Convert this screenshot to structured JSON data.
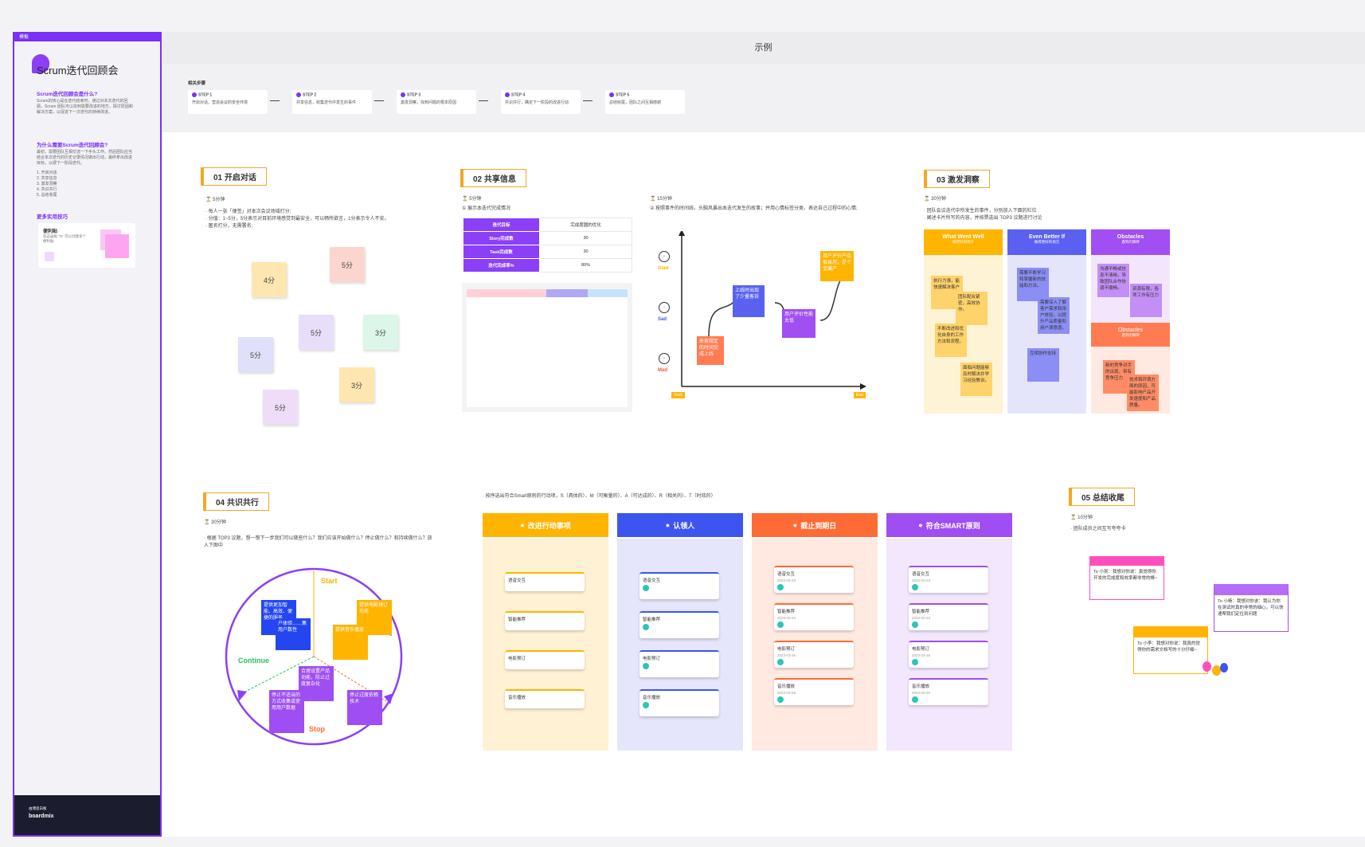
{
  "sidebar": {
    "tag": "模板",
    "title": "Scrum迭代回顾会",
    "h1": "Scrum迭代回顾会是什么?",
    "p1": "Scrum的核心是在迭代结束时，通过对本次迭代的回顾，Scrum 团队可以找到需要改进的地方，探讨原因和解决方案，以促进下一次迭代的持续改进。",
    "h2": "为什么需要Scrum迭代回顾会?",
    "p2": "最初，需要团队互相交流一下手头工作。然后团队应当结合本次迭代的历史记录情况做出行动，最终拿出改进目标，以便下一阶段迭代。",
    "list": [
      "1. 开启对话",
      "2. 共享信息",
      "3. 激发洞察",
      "4. 共识共行",
      "5. 总结收尾"
    ],
    "h3": "更多实用技巧",
    "card_title": "便利贴",
    "card_text": "双击画板 \"N\" 可以创建多个便利贴",
    "footer_brand": "boardmix",
    "footer_label": "由博思白板"
  },
  "header": {
    "title": "示例"
  },
  "steps": {
    "label": "相关步骤",
    "items": [
      {
        "t": "STEP 1",
        "d": "开启对话，营造会议的安全环境"
      },
      {
        "t": "STEP 2",
        "d": "共享信息，收集迭代中发生的事件"
      },
      {
        "t": "STEP 3",
        "d": "激发洞察，找到问题的根本原因"
      },
      {
        "t": "STEP 4",
        "d": "共识共行，确定下一阶段的改进行动"
      },
      {
        "t": "STEP 5",
        "d": "总结收尾，团队之间互相感谢"
      }
    ]
  },
  "s1": {
    "label": "01 开启对话",
    "time": "5分钟",
    "lines": [
      "· 每人一张「便签」对本次会议场域打分;",
      "· 分值：1~5分，5分表示对目前环境感觉到最安全，可以畅所欲言，1分表示令人不安。",
      "· 匿名打分，无需署名;"
    ],
    "stickies": [
      {
        "t": "5分",
        "c": "#fbd6ce"
      },
      {
        "t": "4分",
        "c": "#fde6b0"
      },
      {
        "t": "5分",
        "c": "#e9defa"
      },
      {
        "t": "3分",
        "c": "#dcf7ea"
      },
      {
        "t": "5分",
        "c": "#e1e0fa"
      },
      {
        "t": "3分",
        "c": "#fde6b0"
      },
      {
        "t": "5分",
        "c": "#eedcf9"
      }
    ]
  },
  "s2": {
    "label": "02 共享信息",
    "time": "5分钟",
    "time2": "15分钟",
    "sub1": "① 展示本迭代完成情况",
    "sub2": "② 按照事件的时间线，头脑风暴出本迭代发生的故事；并用心情标签分类，表达自己过程中的心情;",
    "table": [
      [
        "迭代目标",
        "完成度圆的优化"
      ],
      [
        "Story完成数",
        "30"
      ],
      [
        "Task完成数",
        "30"
      ],
      [
        "迭代完成率%",
        "80%"
      ]
    ],
    "moods": [
      "Glad",
      "Sad",
      "Mad"
    ],
    "events": [
      "来按规定的时间完成上线",
      "上线时出现了少量客诉",
      "用户评价性能太低",
      "用户评价产品很易用，是个宝藏产"
    ],
    "axis_start": "Start",
    "axis_end": "End"
  },
  "s3": {
    "label": "03 激发洞察",
    "time": "30分钟",
    "lines": [
      "· 团队会议迭代中所发生的事件，分别放入下面的栏位",
      "· 阐述卡片所写的内容，并按票选出 TOP3 议题进行讨论"
    ],
    "cols": [
      {
        "t": "What Went Well",
        "s": "做得好的地方"
      },
      {
        "t": "Even Better If",
        "s": "做得更好的地方"
      },
      {
        "t": "Obstacles",
        "s": "遇到的障碍"
      }
    ],
    "obst2": {
      "t": "Obstacles",
      "s": "遇到的障碍"
    },
    "notes1": [
      "执行力强，能快速解决客户",
      "团队配合紧密，高效协作。",
      "不断改进和优化自身的工作方法和流程。",
      "面临问题能够及时解决并学习经验教训。"
    ],
    "notes2": [
      "需要不断学习和掌握新的技能和方法。",
      "需要深入了解客户需求和用户体验，以提升产品质量和用户满意度。",
      "互相协作支持"
    ],
    "notes3": [
      "沟通不畅或信息不清晰，导致团队合作协调不顺畅。",
      "资源有限，各项工作有压力",
      "新的竞争对手的出现，带有竞争压力",
      "技术和环境方面的原因，可能影响产品开发速度和产品质量。"
    ]
  },
  "s4": {
    "label": "04 共识共行",
    "time": "30分钟",
    "line": "· 根据 TOP3 议题，想一想下一步我们可以做些什么？我们应该开始做什么？停止做什么？和持续做什么？放入下图中",
    "start": "Start",
    "cont": "Continue",
    "stop": "Stop",
    "boxes": [
      "提供更加智能、高效、便捷的服务",
      "户体验……集用户数性",
      "提供电影预订功能",
      "提供音乐播放",
      "合理设置产品功能，防止过度复杂化",
      "停止不适当的方式收集或使用用户数据",
      "停止过度依赖技术"
    ],
    "rule": "· 按序选出符合Smart原则的行动项，S（具体的）、M（可衡量的）、A（可达成的）、R（相关的）、T（时效的）",
    "board": [
      {
        "h": "改进行动事项",
        "c": "#ffb400",
        "bg": "#fff2d4"
      },
      {
        "h": "认领人",
        "c": "#3d55f0",
        "bg": "#e5e6fb"
      },
      {
        "h": "截止到期日",
        "c": "#ff6b35",
        "bg": "#ffe9e1"
      },
      {
        "h": "符合SMART原则",
        "c": "#9e4ef2",
        "bg": "#f2e7fd"
      }
    ],
    "cards": [
      "语音交互",
      "智能推荐",
      "电影预订",
      "音乐播放"
    ],
    "dates": [
      "2023-03-23",
      "2023-03-24",
      "2023-03-25",
      "2023-03-25"
    ]
  },
  "s5": {
    "label": "05 总结收尾",
    "time": "10分钟",
    "line": "· 团队成员之间互写夸夸卡",
    "cards": [
      "To 小吴：我想对你说：真觉得你开发的完成度和效率都非常的棒~",
      "To 小杨：我想对你说：我认为你在测试时真的非常的细心，可以快速帮我们定位到问题",
      "To 小李：我想对你说：我真的觉得你的需求文档写的十分仔细~"
    ]
  }
}
